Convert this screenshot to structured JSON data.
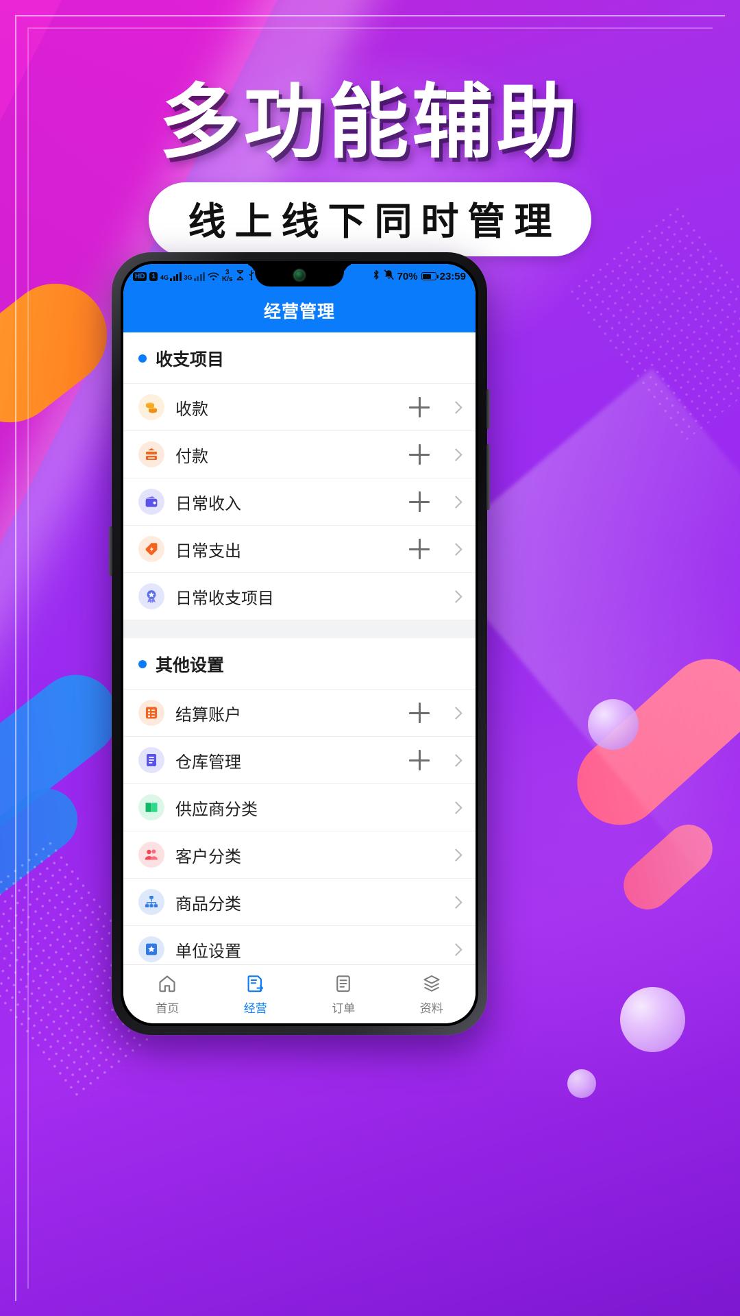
{
  "promo": {
    "title": "多功能辅助",
    "subtitle": "线上线下同时管理"
  },
  "theme": {
    "accent": "#0a7cfb",
    "bg_purple": "#9a28ef",
    "bg_magenta": "#e720d8"
  },
  "phone": {
    "statusbar": {
      "hd_label": "HD",
      "sim_label": "1",
      "net_4g": "4G",
      "net_3g": "3G",
      "speed_value": "3",
      "speed_unit": "K/s",
      "battery_percent": "70%",
      "time": "23:59",
      "icons": [
        "hd-icon",
        "sim-icon",
        "signal-4g-icon",
        "signal-3g-icon",
        "wifi-icon",
        "data-speed-icon",
        "hourglass-icon",
        "usb-icon",
        "bluetooth-icon",
        "mute-bell-icon",
        "battery-icon"
      ]
    },
    "appbar": {
      "title": "经营管理"
    },
    "sections": [
      {
        "title": "收支项目",
        "rows": [
          {
            "label": "收款",
            "icon": "coins-icon",
            "icon_bg": "#fdf0dc",
            "icon_color": "#f7a726",
            "has_plus": true,
            "has_chevron": true
          },
          {
            "label": "付款",
            "icon": "cash-out-icon",
            "icon_bg": "#fdeadd",
            "icon_color": "#f4631e",
            "has_plus": true,
            "has_chevron": true
          },
          {
            "label": "日常收入",
            "icon": "wallet-icon",
            "icon_bg": "#e4e3fc",
            "icon_color": "#5b53e8",
            "has_plus": true,
            "has_chevron": true
          },
          {
            "label": "日常支出",
            "icon": "tag-bolt-icon",
            "icon_bg": "#fdebdd",
            "icon_color": "#f4631e",
            "has_plus": true,
            "has_chevron": true
          },
          {
            "label": "日常收支项目",
            "icon": "badge-star-icon",
            "icon_bg": "#e4e6fc",
            "icon_color": "#5b6ee8",
            "has_plus": false,
            "has_chevron": true
          }
        ]
      },
      {
        "title": "其他设置",
        "rows": [
          {
            "label": "结算账户",
            "icon": "list-card-icon",
            "icon_bg": "#fdeadd",
            "icon_color": "#f4631e",
            "has_plus": true,
            "has_chevron": true
          },
          {
            "label": "仓库管理",
            "icon": "document-icon",
            "icon_bg": "#e4e3fc",
            "icon_color": "#5b53e8",
            "has_plus": true,
            "has_chevron": true
          },
          {
            "label": "供应商分类",
            "icon": "open-book-icon",
            "icon_bg": "#dcf7e8",
            "icon_color": "#1fc071",
            "has_plus": false,
            "has_chevron": true
          },
          {
            "label": "客户分类",
            "icon": "users-icon",
            "icon_bg": "#fde0e2",
            "icon_color": "#f2485b",
            "has_plus": false,
            "has_chevron": true
          },
          {
            "label": "商品分类",
            "icon": "sitemap-icon",
            "icon_bg": "#dde9fb",
            "icon_color": "#2f7ae5",
            "has_plus": false,
            "has_chevron": true
          },
          {
            "label": "单位设置",
            "icon": "star-box-icon",
            "icon_bg": "#dde9fb",
            "icon_color": "#2f7ae5",
            "has_plus": false,
            "has_chevron": true
          }
        ]
      }
    ],
    "bottom_nav": [
      {
        "label": "首页",
        "icon": "home-icon",
        "active": false
      },
      {
        "label": "经营",
        "icon": "business-icon",
        "active": true
      },
      {
        "label": "订单",
        "icon": "order-icon",
        "active": false
      },
      {
        "label": "资料",
        "icon": "layers-icon",
        "active": false
      }
    ]
  }
}
